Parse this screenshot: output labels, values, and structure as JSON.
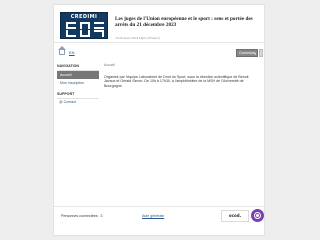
{
  "header": {
    "logo_text": "CREDIMI",
    "title": "Les juges de l'Union européenne et le sport : sens et portée des arrêts du 21 décembre 2023",
    "date": "19-20 mars 2024 Dijon (France)"
  },
  "topbar": {
    "language_link": "EN",
    "toggle_label": "Connexion",
    "toggle_caret": "▾"
  },
  "sidebar": {
    "nav_heading": "NAVIGATION",
    "items": [
      {
        "label": "Accueil"
      },
      {
        "label": "Mon inscription"
      }
    ],
    "support_heading": "SUPPORT",
    "contact_label": "@ Contact"
  },
  "main": {
    "breadcrumb": "Accueil",
    "description": "Organisé par l'équipe Laboratoire de Droit du Sport, sous la direction scientifique de Benoit Javaux et Gérald Simon. De 10h à 17h30, à l'amphithéâtre de la MSH de l'Université de Bourgogne."
  },
  "footer": {
    "connection_label": "Personnes connectées : 3",
    "help_link": "Aide générale",
    "partner_logo_text": "ocod."
  },
  "colors": {
    "logo_bg": "#12395f",
    "active_nav": "#777777",
    "link": "#2b5a8a",
    "ring_logo": "#7b3fb5"
  }
}
